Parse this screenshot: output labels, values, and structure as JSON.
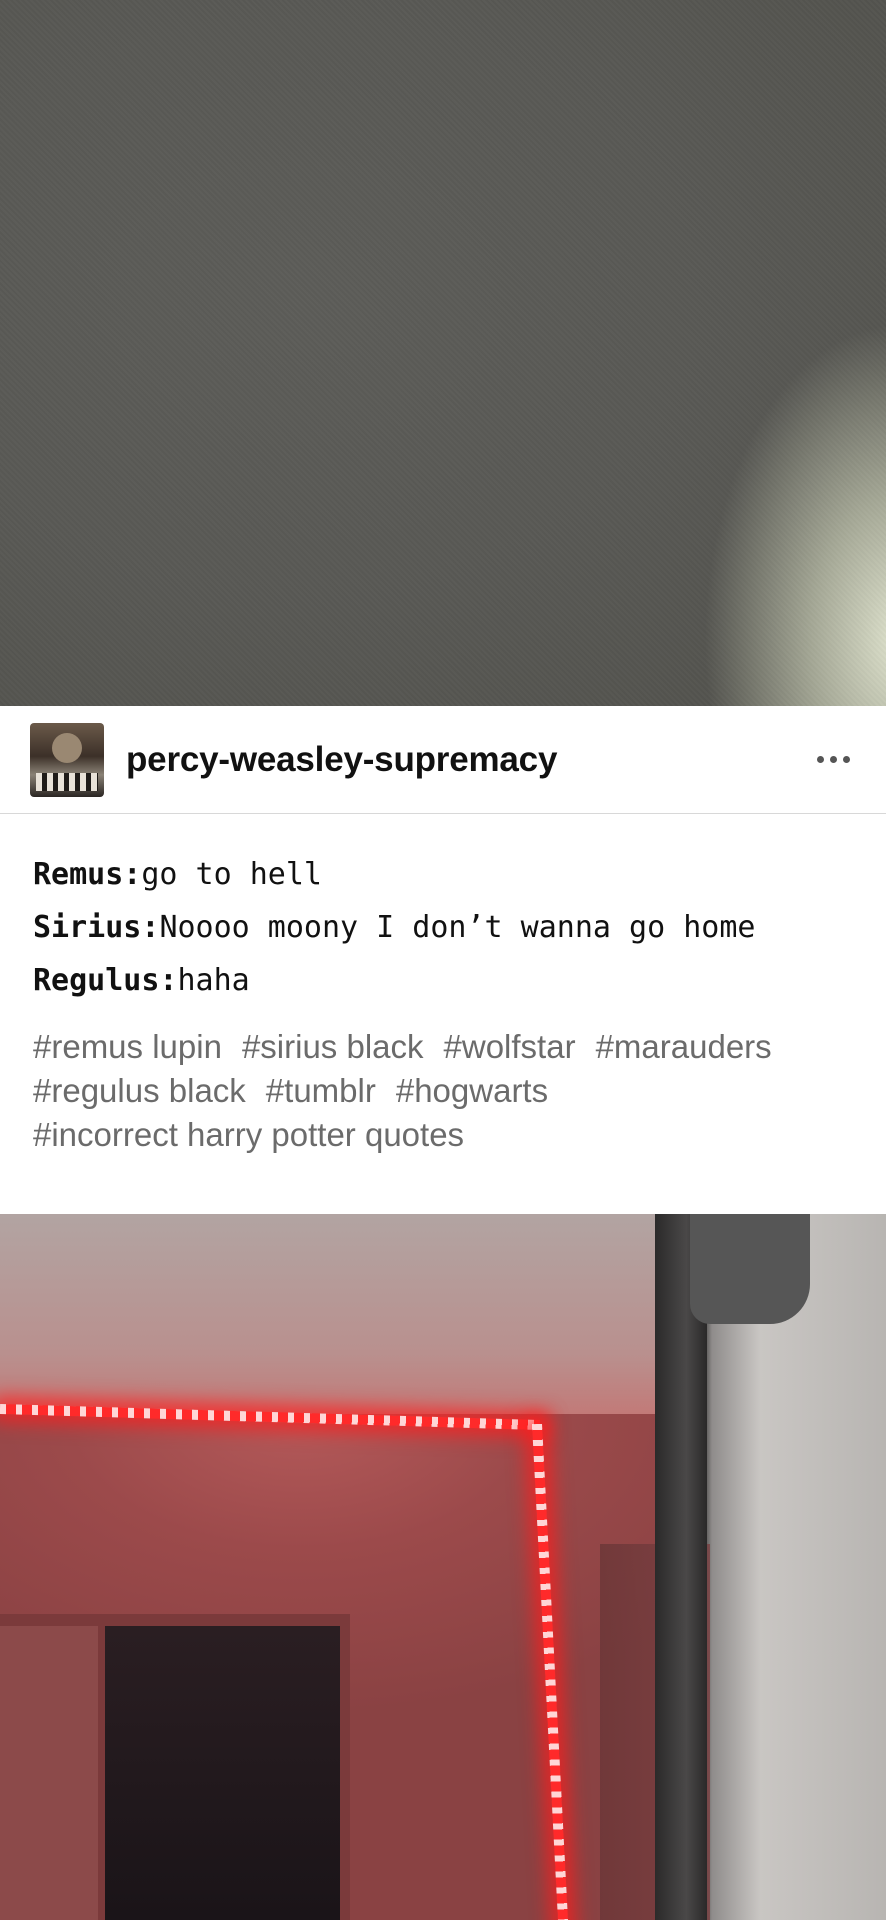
{
  "post": {
    "username": "percy-weasley-supremacy",
    "more_icon": "more-horizontal-icon",
    "chat": [
      {
        "speaker": "Remus:",
        "text": "go to hell"
      },
      {
        "speaker": "Sirius:",
        "text": "Noooo moony I don’t wanna go home"
      },
      {
        "speaker": "Regulus:",
        "text": "haha"
      }
    ],
    "tags": [
      "#remus lupin",
      "#sirius black",
      "#wolfstar",
      "#marauders",
      "#regulus black",
      "#tumblr",
      "#hogwarts",
      "#incorrect harry potter quotes"
    ]
  }
}
